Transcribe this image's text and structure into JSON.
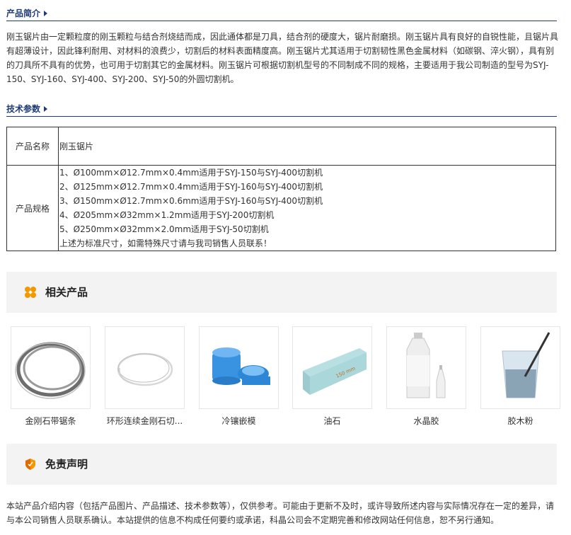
{
  "intro": {
    "heading": "产品简介",
    "text": "刚玉锯片由一定颗粒度的刚玉颗粒与结合剂烧结而成，因此通体都是刀具，结合剂的硬度大，锯片耐磨损。刚玉锯片具有良好的自锐性能，且锯片具有超薄设计，因此锋利耐用、对材料的浪费少，切割后的材料表面精度高。刚玉锯片尤其适用于切割韧性黑色金属材料（如碳钢、淬火钢），具有别的刀具所不具有的优势，也可用于切割其它的金属材料。刚玉锯片可根据切割机型号的不同制成不同的规格，主要适用于我公司制造的型号为SYJ-150、SYJ-160、SYJ-400、SYJ-200、SYJ-50的外圆切割机。"
  },
  "spec": {
    "heading": "技术参数",
    "name_label": "产品名称",
    "name_value": "刚玉锯片",
    "size_label": "产品规格",
    "size_lines": [
      "1、Ø100mm×Ø12.7mm×0.4mm适用于SYJ-150与SYJ-400切割机",
      "2、Ø125mm×Ø12.7mm×0.4mm适用于SYJ-160与SYJ-400切割机",
      "3、Ø150mm×Ø12.7mm×0.6mm适用于SYJ-160与SYJ-400切割机",
      "4、Ø205mm×Ø32mm×1.2mm适用于SYJ-200切割机",
      "5、Ø250mm×Ø32mm×2.0mm适用于SYJ-50切割机",
      "上述为标准尺寸，如需特殊尺寸请与我司销售人员联系！"
    ]
  },
  "related": {
    "heading": "相关产品",
    "icon": "flower-icon",
    "accent": "#f39800",
    "items": [
      {
        "name": "金刚石带锯条",
        "icon": "band-saw-image"
      },
      {
        "name": "环形连续金刚石切...",
        "icon": "wire-loop-image"
      },
      {
        "name": "冷镶嵌模",
        "icon": "mold-cups-image"
      },
      {
        "name": "油石",
        "icon": "oil-stone-image"
      },
      {
        "name": "水晶胶",
        "icon": "bottle-image"
      },
      {
        "name": "胶木粉",
        "icon": "powder-cup-image"
      }
    ]
  },
  "disclaimer": {
    "heading": "免责声明",
    "icon": "shield-icon",
    "text": "本站产品介绍内容（包括产品图片、产品描述、技术参数等），仅供参考。可能由于更新不及时，或许导致所述内容与实际情况存在一定的差异，请与本公司销售人员联系确认。本站提供的信息不构成任何要约或承诺，科晶公司会不定期完善和修改网站任何信息，恕不另行通知。"
  },
  "colors": {
    "heading": "#1f3b73",
    "band": "#f3f3f3"
  }
}
